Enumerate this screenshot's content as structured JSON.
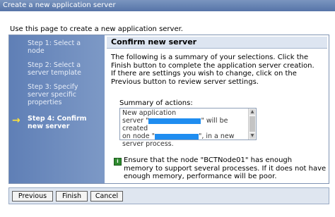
{
  "window": {
    "title": "Create a new application server"
  },
  "intro": "Use this page to create a new application server.",
  "steps": [
    {
      "line1": "Step 1: Select a",
      "line2": "node",
      "line3": ""
    },
    {
      "line1": "Step 2: Select a",
      "line2": "server template",
      "line3": ""
    },
    {
      "line1": "Step 3: Specify",
      "line2": "server specific",
      "line3": "properties"
    },
    {
      "line1": "Step 4: Confirm",
      "line2": "new server",
      "line3": ""
    }
  ],
  "current_step_arrow": "→",
  "content": {
    "heading": "Confirm new server",
    "desc": {
      "line1": "The following is a summary of your selections. Click the",
      "line2": "Finish button to complete the application server creation.",
      "line3": "If there are settings you wish to change, click on the",
      "line4": "Previous button to review server settings."
    },
    "summary_label": "Summary of actions:",
    "summary": {
      "line1": "New application",
      "line2a": "server \"",
      "line2b": "\" will be created",
      "line3a": "on node \"",
      "line3b": "\", in a new",
      "line4": "server process."
    },
    "note": {
      "line1": "Ensure that the node \"BCTNode01\" has enough",
      "line2": "memory to support several processes. If it does not have",
      "line3": "enough memory, performance will be poor."
    }
  },
  "buttons": {
    "previous": "Previous",
    "finish": "Finish",
    "cancel": "Cancel"
  },
  "colors": {
    "sidebar": "#6a88bc",
    "heading_bg": "#dde5f1",
    "redaction": "#1f8df0",
    "arrow": "#ffe23a"
  }
}
